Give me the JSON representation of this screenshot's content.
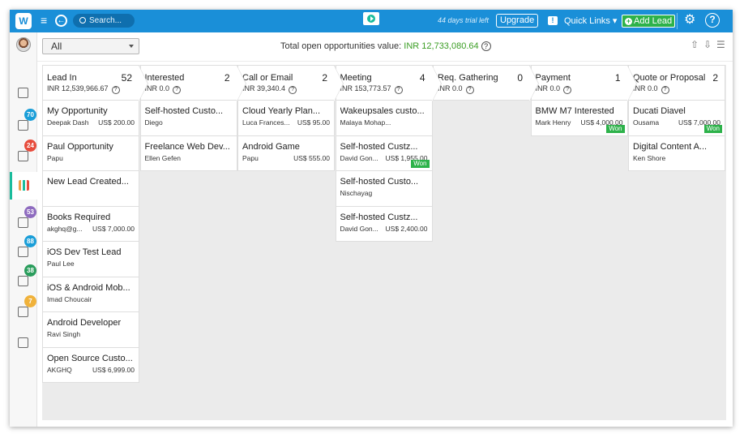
{
  "topbar": {
    "search_placeholder": "Search...",
    "trial": "44 days trial left",
    "upgrade": "Upgrade",
    "quick_links": "Quick Links ▾",
    "add_lead": "Add Lead"
  },
  "sidebar": {
    "badges": [
      "70",
      "24",
      "53",
      "88",
      "38",
      "7"
    ],
    "badge_colors": [
      "#1a9ed8",
      "#e74c3c",
      "#8e6bbf",
      "#1a9ed8",
      "#2a9d5c",
      "#f0b23b"
    ]
  },
  "subhead": {
    "filter": "All",
    "total_label": "Total open opportunities value: ",
    "total_value": "INR 12,733,080.64"
  },
  "columns": [
    {
      "name": "Lead In",
      "count": "52",
      "value": "INR 12,539,966.67",
      "cards": [
        {
          "title": "My Opportunity",
          "owner": "Deepak Dash",
          "amount": "US$ 200.00",
          "won": ""
        },
        {
          "title": "Paul Opportunity",
          "owner": "Papu",
          "amount": "",
          "won": ""
        },
        {
          "title": "New Lead Created...",
          "owner": "",
          "amount": "",
          "won": ""
        },
        {
          "title": "Books Required",
          "owner": "akghq@g...",
          "amount": "US$ 7,000.00",
          "won": ""
        },
        {
          "title": "iOS Dev Test Lead",
          "owner": "Paul Lee",
          "amount": "",
          "won": ""
        },
        {
          "title": "iOS & Android Mob...",
          "owner": "Imad Choucair",
          "amount": "",
          "won": ""
        },
        {
          "title": "Android Developer",
          "owner": "Ravi Singh",
          "amount": "",
          "won": ""
        },
        {
          "title": "Open Source Custo...",
          "owner": "AKGHQ",
          "amount": "US$ 6,999.00",
          "won": ""
        }
      ]
    },
    {
      "name": "Interested",
      "count": "2",
      "value": "INR 0.0",
      "cards": [
        {
          "title": "Self-hosted Custo...",
          "owner": "Diego",
          "amount": "",
          "won": ""
        },
        {
          "title": "Freelance Web Dev...",
          "owner": "Ellen Gefen",
          "amount": "",
          "won": ""
        }
      ]
    },
    {
      "name": "Call or Email",
      "count": "2",
      "value": "INR 39,340.4",
      "cards": [
        {
          "title": "Cloud Yearly Plan...",
          "owner": "Luca Frances...",
          "amount": "US$ 95.00",
          "won": ""
        },
        {
          "title": "Android Game",
          "owner": "Papu",
          "amount": "US$ 555.00",
          "won": ""
        }
      ]
    },
    {
      "name": "Meeting",
      "count": "4",
      "value": "INR 153,773.57",
      "cards": [
        {
          "title": "Wakeupsales custo...",
          "owner": "Malaya Mohap...",
          "amount": "",
          "won": ""
        },
        {
          "title": "Self-hosted Custz...",
          "owner": "David Gon...",
          "amount": "US$ 1,955.00",
          "won": "Won"
        },
        {
          "title": "Self-hosted Custo...",
          "owner": "Nischayag",
          "amount": "",
          "won": ""
        },
        {
          "title": "Self-hosted Custz...",
          "owner": "David Gon...",
          "amount": "US$ 2,400.00",
          "won": ""
        }
      ]
    },
    {
      "name": "Req. Gathering",
      "count": "0",
      "value": "INR 0.0",
      "cards": []
    },
    {
      "name": "Payment",
      "count": "1",
      "value": "INR 0.0",
      "cards": [
        {
          "title": "BMW M7 Interested",
          "owner": "Mark Henry",
          "amount": "US$ 4,000.00",
          "won": "Won"
        }
      ]
    },
    {
      "name": "Quote or Proposal",
      "count": "2",
      "value": "INR 0.0",
      "cards": [
        {
          "title": "Ducati Diavel",
          "owner": "Ousama",
          "amount": "US$ 7,000.00",
          "won": "Won"
        },
        {
          "title": "Digital Content A...",
          "owner": "Ken Shore",
          "amount": "",
          "won": ""
        }
      ]
    }
  ]
}
